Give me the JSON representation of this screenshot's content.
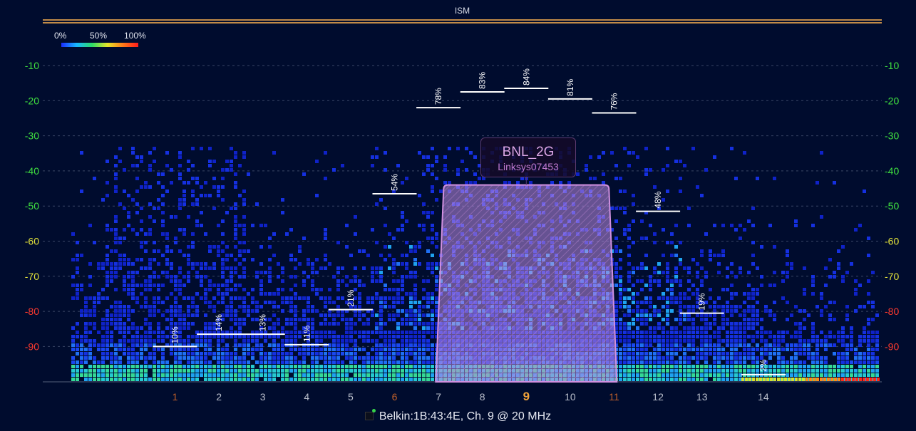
{
  "band": {
    "label": "ISM"
  },
  "legend": {
    "low": "0%",
    "mid": "50%",
    "high": "100%"
  },
  "y_axis": {
    "ticks": [
      {
        "label": "-10",
        "value": -10,
        "color": "#3fe03f"
      },
      {
        "label": "-20",
        "value": -20,
        "color": "#3fe03f"
      },
      {
        "label": "-30",
        "value": -30,
        "color": "#3fe03f"
      },
      {
        "label": "-40",
        "value": -40,
        "color": "#3fe03f"
      },
      {
        "label": "-50",
        "value": -50,
        "color": "#3fe03f"
      },
      {
        "label": "-60",
        "value": -60,
        "color": "#e3e33a"
      },
      {
        "label": "-70",
        "value": -70,
        "color": "#e3e33a"
      },
      {
        "label": "-80",
        "value": -80,
        "color": "#ff3a2e"
      },
      {
        "label": "-90",
        "value": -90,
        "color": "#ff3a2e"
      }
    ],
    "range": [
      -100,
      -5
    ]
  },
  "x_axis": {
    "channels": [
      {
        "label": "1",
        "ch": 1,
        "color": "#c0602a"
      },
      {
        "label": "2",
        "ch": 2,
        "color": "#b9bfcc"
      },
      {
        "label": "3",
        "ch": 3,
        "color": "#b9bfcc"
      },
      {
        "label": "4",
        "ch": 4,
        "color": "#b9bfcc"
      },
      {
        "label": "5",
        "ch": 5,
        "color": "#b9bfcc"
      },
      {
        "label": "6",
        "ch": 6,
        "color": "#c0602a"
      },
      {
        "label": "7",
        "ch": 7,
        "color": "#b9bfcc"
      },
      {
        "label": "8",
        "ch": 8,
        "color": "#b9bfcc"
      },
      {
        "label": "9",
        "ch": 9,
        "color": "#f0a23a",
        "selected": true
      },
      {
        "label": "10",
        "ch": 10,
        "color": "#b9bfcc"
      },
      {
        "label": "11",
        "ch": 11,
        "color": "#c0602a"
      },
      {
        "label": "12",
        "ch": 12,
        "color": "#b9bfcc"
      },
      {
        "label": "13",
        "ch": 13,
        "color": "#b9bfcc"
      },
      {
        "label": "14",
        "ch": 14,
        "color": "#b9bfcc"
      }
    ]
  },
  "utilization": [
    {
      "ch": 1,
      "label": "10%",
      "dbm": -90
    },
    {
      "ch": 2,
      "label": "14%",
      "dbm": -86.5
    },
    {
      "ch": 3,
      "label": "13%",
      "dbm": -86.5
    },
    {
      "ch": 4,
      "label": "11%",
      "dbm": -89.5
    },
    {
      "ch": 5,
      "label": "21%",
      "dbm": -79.5
    },
    {
      "ch": 6,
      "label": "54%",
      "dbm": -46.5
    },
    {
      "ch": 7,
      "label": "78%",
      "dbm": -22
    },
    {
      "ch": 8,
      "label": "83%",
      "dbm": -17.5
    },
    {
      "ch": 9,
      "label": "84%",
      "dbm": -16.5
    },
    {
      "ch": 10,
      "label": "81%",
      "dbm": -19.5
    },
    {
      "ch": 11,
      "label": "76%",
      "dbm": -23.5
    },
    {
      "ch": 12,
      "label": "48%",
      "dbm": -51.5
    },
    {
      "ch": 13,
      "label": "19%",
      "dbm": -80.5
    },
    {
      "ch": 14,
      "label": "2%",
      "dbm": -98
    }
  ],
  "network": {
    "ssid": "BNL_2G",
    "vendor": "Linksys07453",
    "channel": 9,
    "width_mhz": 20,
    "signal_dbm": -44,
    "color": "#d090e0"
  },
  "footer": {
    "text": "Belkin:1B:43:4E, Ch. 9 @ 20 MHz"
  },
  "colors": {
    "background": "#000c2e",
    "grid": "#3a4666",
    "selected_channel": "#f0a23a"
  }
}
